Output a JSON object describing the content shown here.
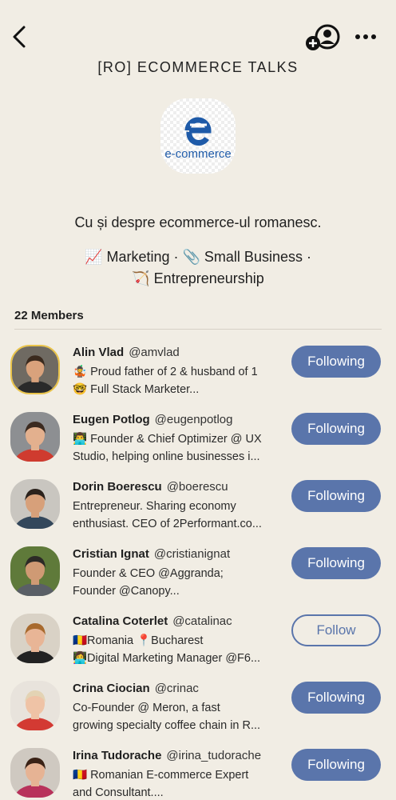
{
  "header": {
    "title": "[RO] ECOMMERCE TALKS",
    "back_icon": "chevron-left-icon",
    "add_icon": "add-member-icon",
    "more_icon": "more-horizontal-icon"
  },
  "club": {
    "logo_text": "e-commerce",
    "logo_color": "#1e5aa8",
    "description": "Cu și despre ecommerce-ul romanesc.",
    "topics": [
      {
        "emoji": "📈",
        "label": "Marketing"
      },
      {
        "emoji": "📎",
        "label": "Small Business"
      },
      {
        "emoji": "🏹",
        "label": "Entrepreneurship"
      }
    ],
    "separator": " · "
  },
  "members": {
    "count_label": "22 Members",
    "items": [
      {
        "name": "Alin Vlad",
        "handle": "@amvlad",
        "bio1": "🤹 Proud father of 2 & husband of 1",
        "bio2": "🤓 Full Stack Marketer...",
        "button": "Following",
        "state": "following",
        "skin": "#d9a27c",
        "hair": "#3a2a1e",
        "bg": "#6f6a62",
        "shirt": "#2a2a2a"
      },
      {
        "name": "Eugen Potlog",
        "handle": "@eugenpotlog",
        "bio1": "👨‍💻 Founder & Chief Optimizer @ UX",
        "bio2": "Studio, helping online businesses i...",
        "button": "Following",
        "state": "following",
        "skin": "#e3b08e",
        "hair": "#3b2a20",
        "bg": "#8d8f92",
        "shirt": "#cf3b2f"
      },
      {
        "name": "Dorin Boerescu",
        "handle": "@boerescu",
        "bio1": "Entrepreneur. Sharing economy",
        "bio2": "enthusiast. CEO of 2Performant.co...",
        "button": "Following",
        "state": "following",
        "skin": "#d7a07a",
        "hair": "#2b221c",
        "bg": "#c9c6c0",
        "shirt": "#33475b"
      },
      {
        "name": "Cristian Ignat",
        "handle": "@cristianignat",
        "bio1": "Founder & CEO @Aggranda;",
        "bio2": "Founder @Canopy...",
        "button": "Following",
        "state": "following",
        "skin": "#cf9a74",
        "hair": "#2c2a26",
        "bg": "#5f7a3a",
        "shirt": "#5a5f66"
      },
      {
        "name": "Catalina Coterlet",
        "handle": "@catalinac",
        "bio1": "🇷🇴Romania 📍Bucharest",
        "bio2": "👩‍💻Digital Marketing Manager @F6...",
        "button": "Follow",
        "state": "follow",
        "skin": "#e8b596",
        "hair": "#a86a2e",
        "bg": "#d9d2c6",
        "shirt": "#222222"
      },
      {
        "name": "Crina Ciocian",
        "handle": "@crinac",
        "bio1": "Co-Founder @ Meron, a fast",
        "bio2": "growing specialty coffee chain in R...",
        "button": "Following",
        "state": "following",
        "skin": "#efc3a6",
        "hair": "#e3d3b4",
        "bg": "#e8e3dc",
        "shirt": "#d33a33"
      },
      {
        "name": "Irina Tudorache",
        "handle": "@irina_tudorache",
        "bio1": "🇷🇴 Romanian E-commerce Expert",
        "bio2": "and Consultant....",
        "button": "Following",
        "state": "following",
        "skin": "#e6b394",
        "hair": "#3a2216",
        "bg": "#cfc9c1",
        "shirt": "#b8325b"
      }
    ]
  },
  "colors": {
    "background": "#f1ede4",
    "accent": "#5a75ab"
  }
}
